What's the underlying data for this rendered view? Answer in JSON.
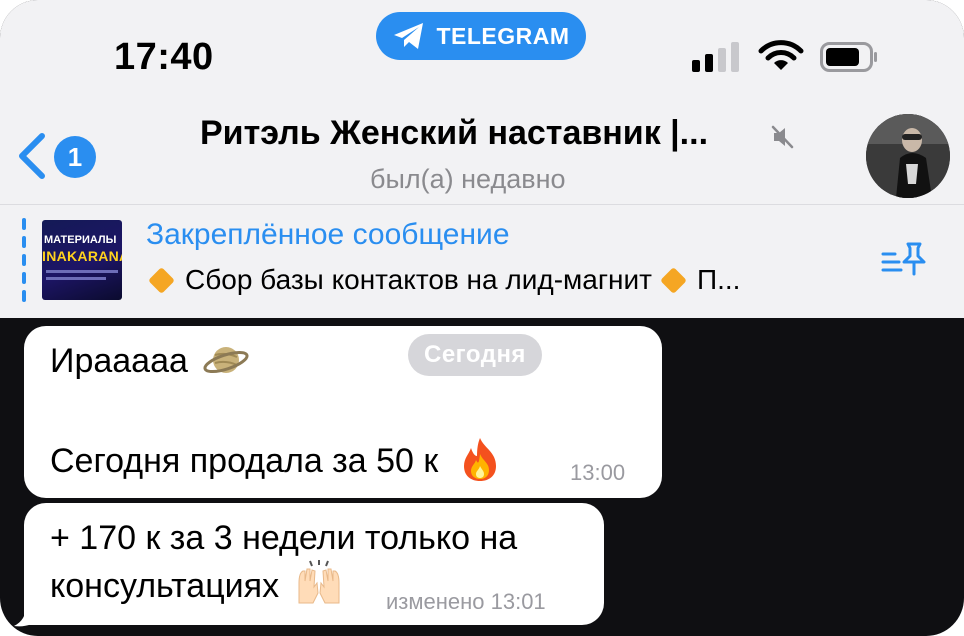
{
  "status_bar": {
    "time": "17:40",
    "app_pill": "TELEGRAM"
  },
  "header": {
    "back_badge": "1",
    "title": "Ритэль Женский наставник |...",
    "subtitle": "был(а) недавно"
  },
  "pinned": {
    "title": "Закреплённое сообщение",
    "text_part1": "Сбор базы контактов на лид-магнит",
    "text_part2": "П...",
    "thumb_line1": "МАТЕРИАЛЫ",
    "thumb_line2": "INAKARANA"
  },
  "date_separator": "Сегодня",
  "messages": [
    {
      "line1": "Ирааааа",
      "line1_emoji": "saturn-icon",
      "line2": "Сегодня продала за 50 к",
      "line2_emoji": "fire-icon",
      "time": "13:00"
    },
    {
      "line1": "+ 170 к за 3 недели только на",
      "line2": "консультациях",
      "line2_emoji": "raised-hands-icon",
      "time": "изменено 13:01"
    }
  ],
  "colors": {
    "accent": "#2a8ef0",
    "header_bg": "#f2f2f4",
    "chat_bg": "#0f0f12",
    "bubble_bg": "#ffffff",
    "pin_diamond": "#f5a623"
  }
}
